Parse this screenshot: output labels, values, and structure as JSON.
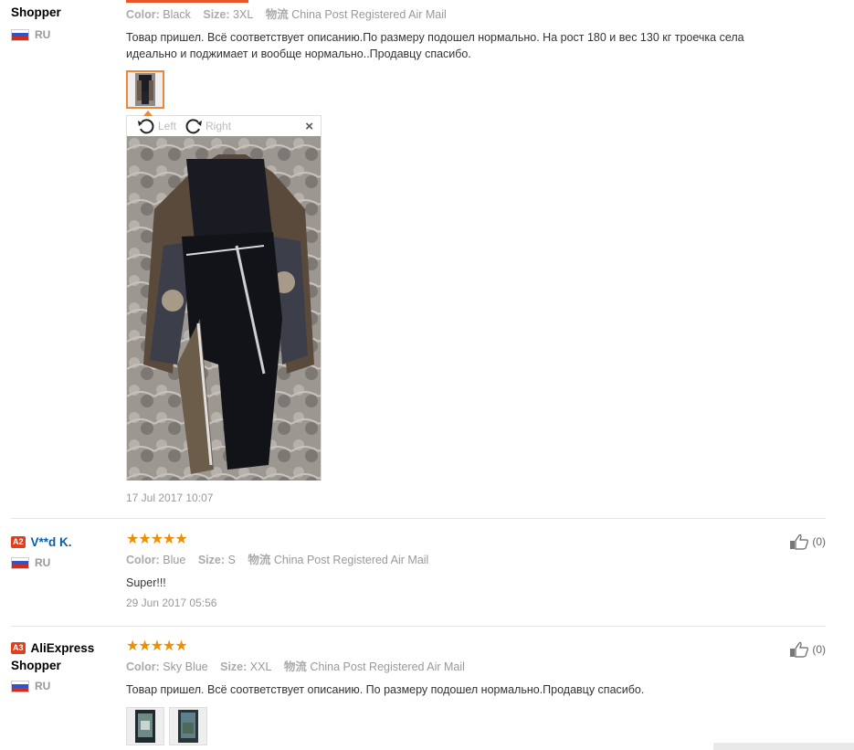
{
  "reviews": [
    {
      "author_name": "Shopper",
      "country": "RU",
      "color_label": "Color:",
      "color_value": "Black",
      "size_label": "Size:",
      "size_value": "3XL",
      "shipping_label": "物流",
      "shipping_value": "China Post Registered Air Mail",
      "text_line1": "Товар пришел. Всё соответствует описанию.По размеру подошел нормально. На рост 180 и вес 130 кг троечка села",
      "text_line2": "идеально и поджимает и вообще нормально..Продавцу спасибо.",
      "viewer": {
        "left_label": "Left",
        "right_label": "Right",
        "close_label": "×"
      },
      "date": "17 Jul 2017 10:07"
    },
    {
      "level": "A2",
      "author_name": "V**d K.",
      "country": "RU",
      "stars": "★★★★★",
      "color_label": "Color:",
      "color_value": "Blue",
      "size_label": "Size:",
      "size_value": "S",
      "shipping_label": "物流",
      "shipping_value": "China Post Registered Air Mail",
      "text": "Super!!!",
      "date": "29 Jun 2017 05:56",
      "helpful_count": "(0)"
    },
    {
      "level": "A3",
      "author_name_line1": "AliExpress",
      "author_name_line2": "Shopper",
      "country": "RU",
      "stars": "★★★★★",
      "color_label": "Color:",
      "color_value": "Sky Blue",
      "size_label": "Size:",
      "size_value": "XXL",
      "shipping_label": "物流",
      "shipping_value": "China Post Registered Air Mail",
      "text": "Товар пришел. Всё соответствует описанию. По размеру подошел нормально.Продавцу спасибо.",
      "helpful_count": "(0)"
    }
  ],
  "colors": {
    "accent": "#e8562a",
    "star": "#f08d00",
    "badge": "#e2401c",
    "link": "#0a5eaa"
  },
  "icons": [
    "flag-ru-icon",
    "rotate-left-icon",
    "rotate-right-icon",
    "close-icon",
    "thumbs-up-icon",
    "star-icon"
  ]
}
